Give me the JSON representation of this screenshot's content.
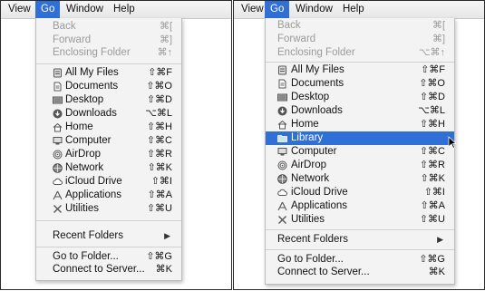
{
  "menubar": {
    "view": "View",
    "go": "Go",
    "window": "Window",
    "help": "Help"
  },
  "items": {
    "back": {
      "label": "Back",
      "shortcut": "⌘["
    },
    "forward": {
      "label": "Forward",
      "shortcut": "⌘]"
    },
    "enclosing": {
      "label": "Enclosing Folder",
      "shortcut": "⌘↑"
    },
    "enclosing_alt": {
      "label": "Enclosing Folder",
      "shortcut": "⌥⌘↑"
    },
    "all_my_files": {
      "label": "All My Files",
      "shortcut": "⇧⌘F"
    },
    "documents": {
      "label": "Documents",
      "shortcut": "⇧⌘O"
    },
    "desktop": {
      "label": "Desktop",
      "shortcut": "⇧⌘D"
    },
    "downloads": {
      "label": "Downloads",
      "shortcut": "⌥⌘L"
    },
    "home": {
      "label": "Home",
      "shortcut": "⇧⌘H"
    },
    "library": {
      "label": "Library",
      "shortcut": ""
    },
    "computer": {
      "label": "Computer",
      "shortcut": "⇧⌘C"
    },
    "airdrop": {
      "label": "AirDrop",
      "shortcut": "⇧⌘R"
    },
    "network": {
      "label": "Network",
      "shortcut": "⇧⌘K"
    },
    "icloud": {
      "label": "iCloud Drive",
      "shortcut": "⇧⌘I"
    },
    "applications": {
      "label": "Applications",
      "shortcut": "⇧⌘A"
    },
    "utilities": {
      "label": "Utilities",
      "shortcut": "⇧⌘U"
    },
    "recent": {
      "label": "Recent Folders",
      "arrow": "▶"
    },
    "goto": {
      "label": "Go to Folder...",
      "shortcut": "⇧⌘G"
    },
    "connect": {
      "label": "Connect to Server...",
      "shortcut": "⌘K"
    }
  },
  "colors": {
    "highlight": "#2f6fd6",
    "disabled": "#9a9a9a"
  }
}
